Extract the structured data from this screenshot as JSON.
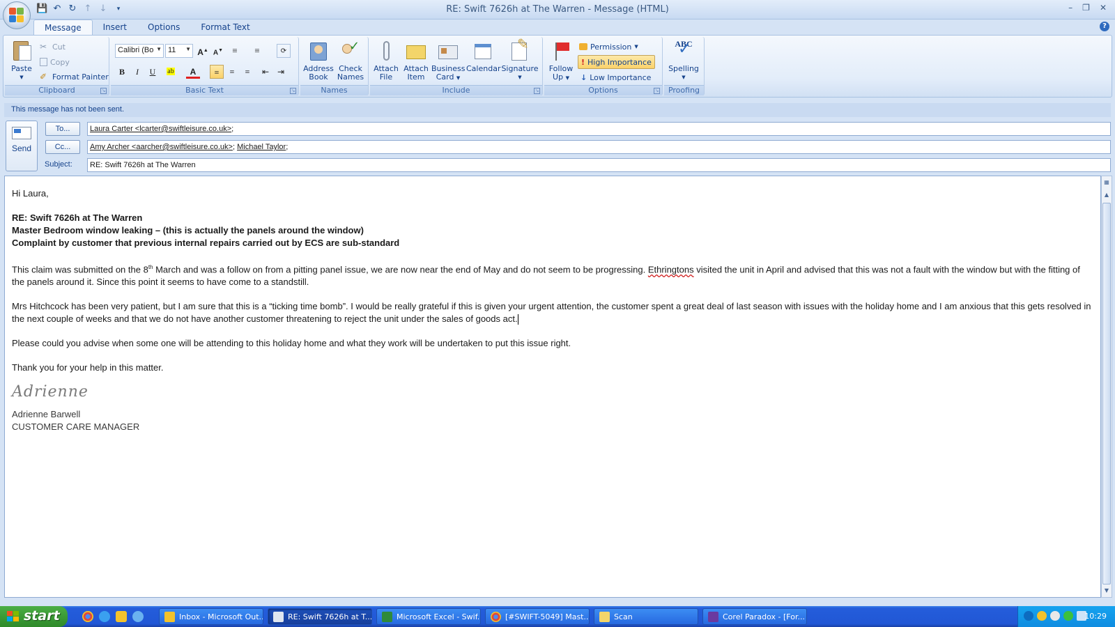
{
  "window": {
    "title": "RE: Swift 7626h at The Warren - Message (HTML)"
  },
  "ribbon": {
    "tabs": [
      "Message",
      "Insert",
      "Options",
      "Format Text"
    ],
    "clipboard": {
      "label": "Clipboard",
      "paste": "Paste",
      "cut": "Cut",
      "copy": "Copy",
      "format_painter": "Format Painter"
    },
    "basic_text": {
      "label": "Basic Text",
      "font": "Calibri (Bo",
      "size": "11"
    },
    "names": {
      "label": "Names",
      "address_book_1": "Address",
      "address_book_2": "Book",
      "check_names_1": "Check",
      "check_names_2": "Names"
    },
    "include": {
      "label": "Include",
      "attach_file_1": "Attach",
      "attach_file_2": "File",
      "attach_item_1": "Attach",
      "attach_item_2": "Item",
      "business_card_1": "Business",
      "business_card_2": "Card",
      "calendar": "Calendar",
      "signature": "Signature"
    },
    "options": {
      "label": "Options",
      "follow_up_1": "Follow",
      "follow_up_2": "Up",
      "permission": "Permission",
      "high_importance": "High Importance",
      "low_importance": "Low Importance"
    },
    "proofing": {
      "label": "Proofing",
      "spelling": "Spelling",
      "abc": "ABC"
    }
  },
  "infobar": "This message has not been sent.",
  "header": {
    "send": "Send",
    "to_button": "To...",
    "cc_button": "Cc...",
    "subject_label": "Subject:",
    "to_value": "Laura Carter <lcarter@swiftleisure.co.uk>",
    "cc_value_1": "Amy Archer <aarcher@swiftleisure.co.uk>",
    "cc_value_2": "Michael Taylor",
    "subject_value": "RE: Swift 7626h at The Warren"
  },
  "body": {
    "greeting": "Hi Laura,",
    "bold_1": "RE: Swift 7626h at The Warren",
    "bold_2": "Master Bedroom window leaking – (this is actually the panels around the window)",
    "bold_3": "Complaint by customer that  previous internal repairs carried out by ECS are sub-standard",
    "p1_a": "This claim was submitted on the 8",
    "p1_sup": "th",
    "p1_b": " March and was a follow on from a pitting panel issue,  we are now near the end of May and do not seem to be progressing.  ",
    "p1_c": "Ethringtons",
    "p1_d": " visited the unit in April and advised that this was not a fault with the window but with the fitting of the panels around it.  Since this point it seems to have come to a standstill.",
    "p2": "Mrs Hitchcock has been very patient, but I am sure that this is a “ticking time bomb”.  I would be really grateful if this is given your urgent attention, the customer spent a great deal of last season with issues with the holiday home and I am anxious that this gets resolved in the next couple of weeks and that we do not have another customer threatening to reject the unit under the sales of goods act.",
    "p3": "Please could you advise when some one will be attending to this holiday home and what they work will be undertaken to put this issue right.",
    "p4": "Thank you for your help in this matter.",
    "sig_script": "Adrienne",
    "sig_name": "Adrienne Barwell",
    "sig_title": "CUSTOMER CARE MANAGER"
  },
  "taskbar": {
    "start": "start",
    "items": [
      "Inbox - Microsoft Out...",
      "RE: Swift 7626h at T...",
      "Microsoft Excel - Swif...",
      "[#SWIFT-5049] Mast...",
      "Scan",
      "Corel Paradox - [For..."
    ],
    "clock": "10:29"
  },
  "colors": {
    "ribbon_bg": "#e3edfa",
    "taskbar_blue": "#245ddb",
    "start_green": "#3b9b36",
    "high_importance_bg": "#fbd26a"
  }
}
